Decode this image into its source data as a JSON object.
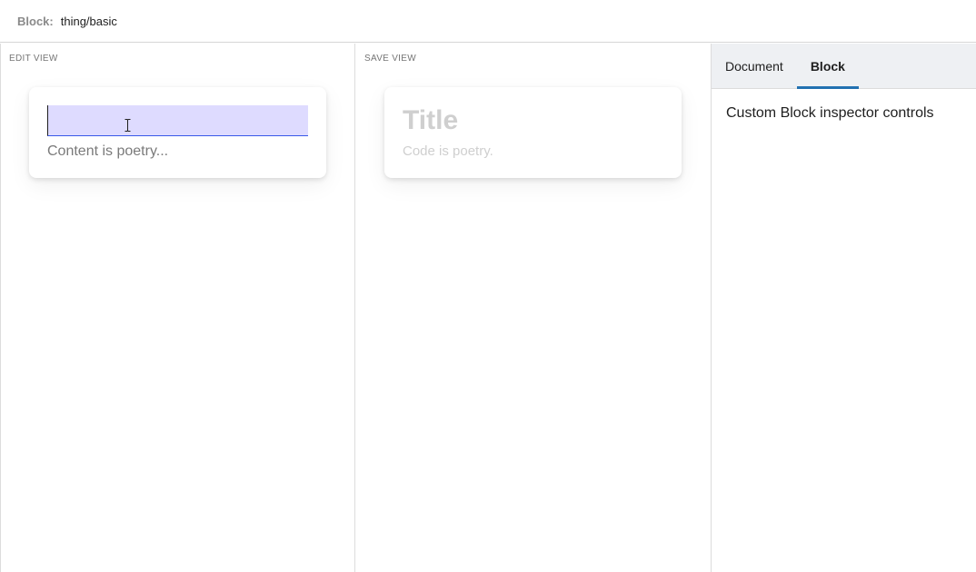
{
  "header": {
    "block_label": "Block:",
    "block_name": "thing/basic"
  },
  "edit_view": {
    "label": "EDIT VIEW",
    "title_value": "",
    "content_placeholder": "Content is poetry..."
  },
  "save_view": {
    "label": "SAVE VIEW",
    "title": "Title",
    "code_placeholder": "Code is poetry."
  },
  "sidebar": {
    "tabs": [
      {
        "label": "Document"
      },
      {
        "label": "Block"
      }
    ],
    "active_tab": "Block",
    "body_text": "Custom Block inspector controls"
  },
  "colors": {
    "accent": "#2271b1",
    "selection": "#dedbff",
    "focus_underline": "#3858e9"
  }
}
